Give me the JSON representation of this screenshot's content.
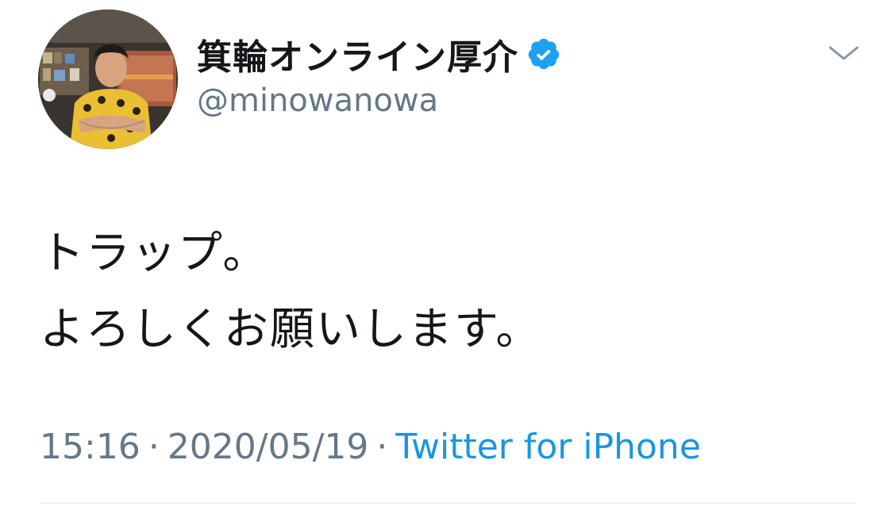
{
  "author": {
    "display_name": "箕輪オンライン厚介",
    "handle": "@minowanowa",
    "verified": true,
    "verified_icon": "verified-badge-icon"
  },
  "tweet": {
    "text": "トラップ。\nよろしくお願いします。",
    "time": "15:16",
    "separator": "·",
    "date": "2020/05/19",
    "source": "Twitter for iPhone"
  },
  "menu_icon": "chevron-down-icon",
  "colors": {
    "text": "#14171a",
    "secondary": "#657786",
    "link": "#1b95e0",
    "verified": "#1da1f2",
    "divider": "#e1e8ed"
  }
}
